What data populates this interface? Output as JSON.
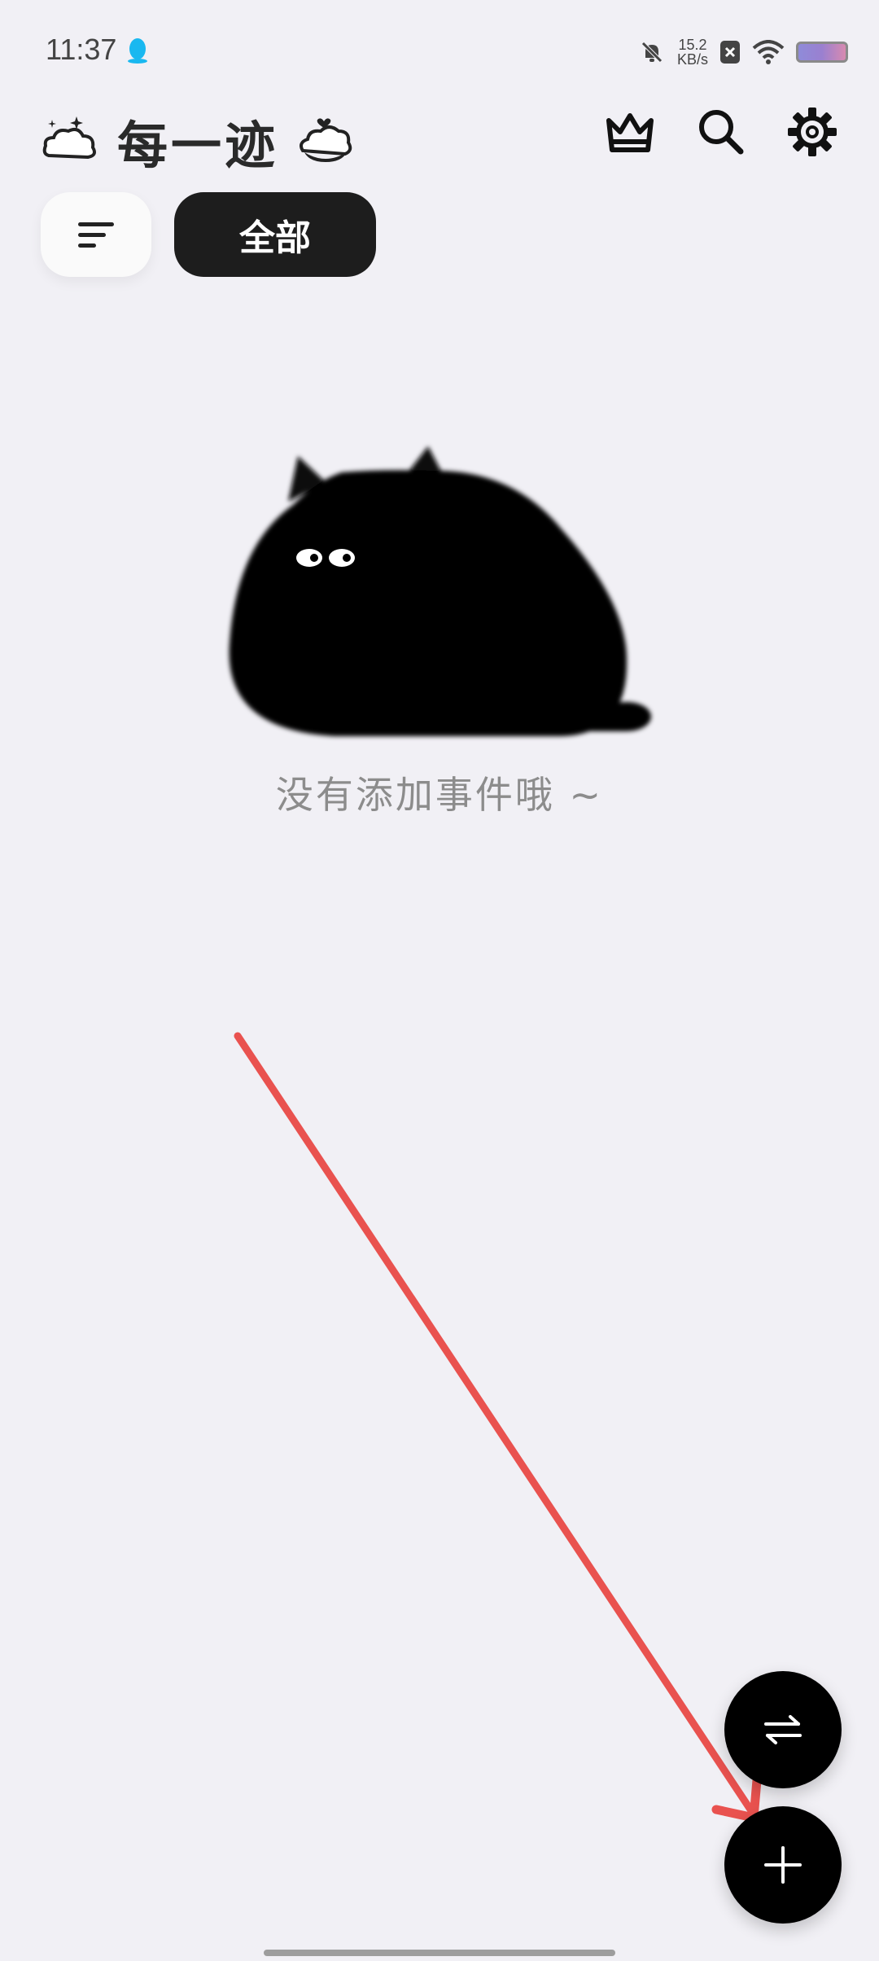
{
  "status_bar": {
    "time": "11:37",
    "net_speed_value": "15.2",
    "net_speed_unit": "KB/s",
    "icons": [
      "qq-icon",
      "bell-off-icon",
      "sim-off-icon",
      "wifi-icon",
      "battery-icon"
    ]
  },
  "header": {
    "title": "每一迹",
    "left_deco_icon": "cloud-sparkle-icon",
    "right_deco_icon": "cloud-heart-icon",
    "actions": [
      "crown-icon",
      "search-icon",
      "settings-gear-icon"
    ]
  },
  "filters": {
    "sort_icon": "sort-lines-icon",
    "active_chip": "全部"
  },
  "empty_state": {
    "illustration": "black-cat-illustration",
    "message": "没有添加事件哦 ~"
  },
  "fabs": {
    "swap_icon": "swap-arrows-icon",
    "add_icon": "plus-icon"
  },
  "colors": {
    "background": "#f1f0f5",
    "chip_dark": "#1d1d1d",
    "annotation_red": "#e9524f"
  }
}
